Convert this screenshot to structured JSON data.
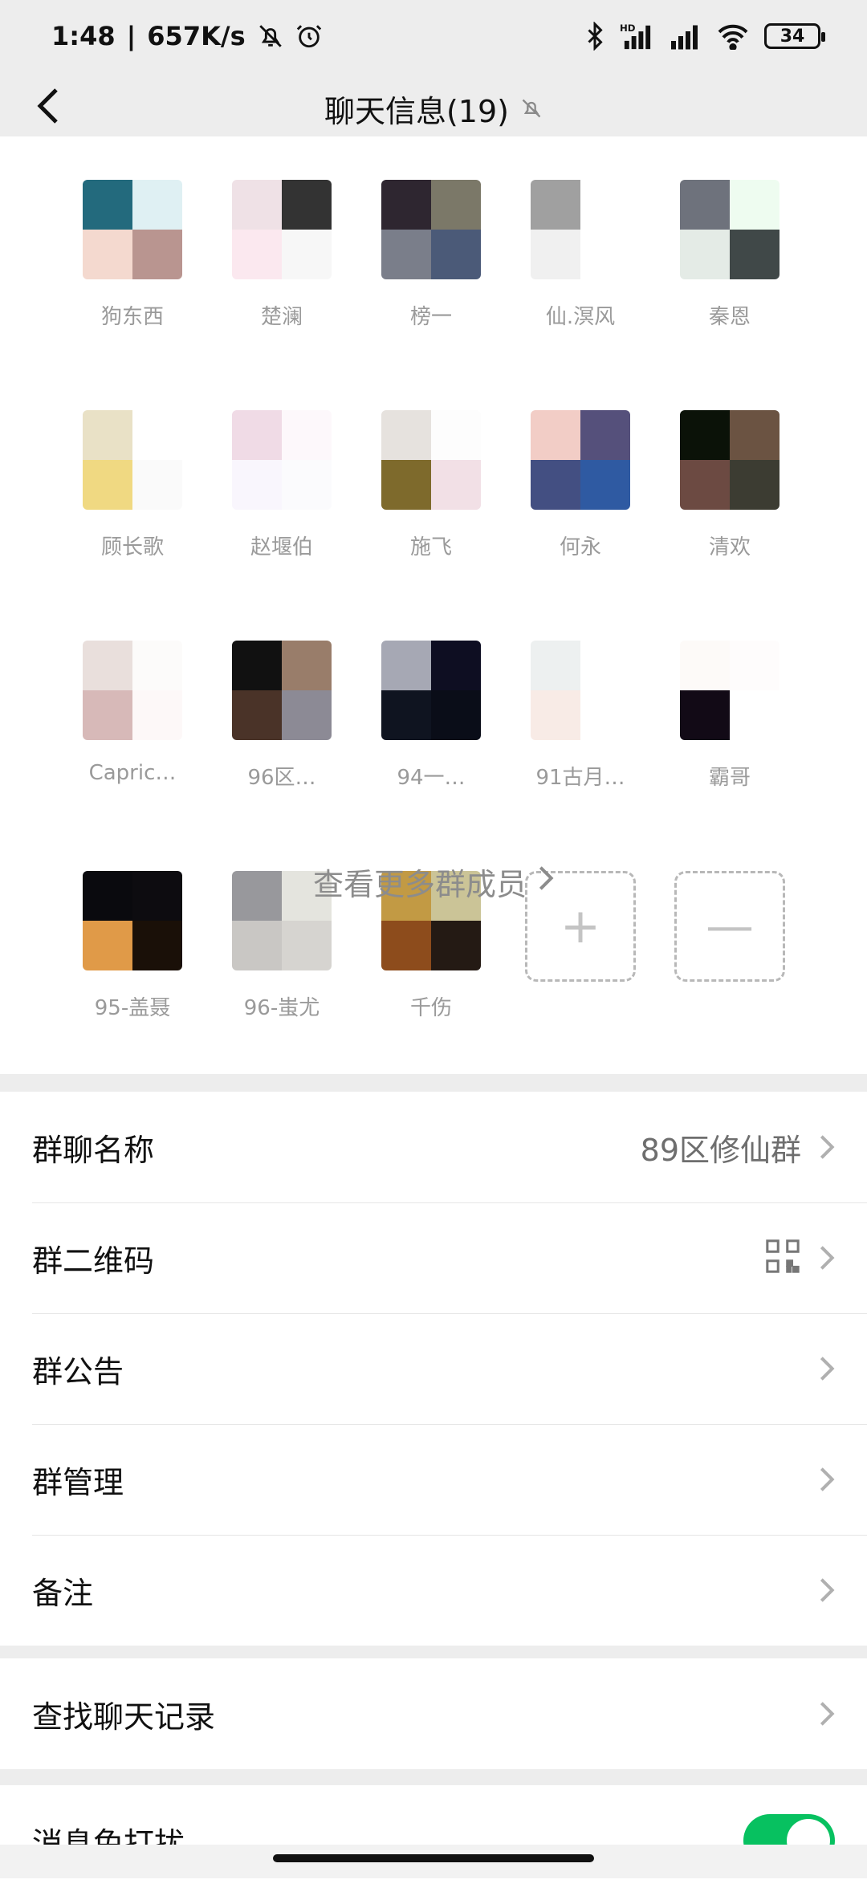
{
  "status_bar": {
    "time": "1:48",
    "network_speed": "657K/s",
    "battery": "34",
    "icons": [
      "bell-off-icon",
      "alarm-icon",
      "bluetooth-icon",
      "signal-hd-icon",
      "signal-icon",
      "wifi-icon",
      "battery-icon"
    ]
  },
  "header": {
    "title": "聊天信息(19)",
    "back_icon": "chevron-left-icon",
    "mute_icon": "bell-off-icon"
  },
  "members": [
    {
      "name": "狗东西",
      "colors": [
        "#236a7d",
        "#dff0f3",
        "#f4d9cf",
        "#b99590"
      ]
    },
    {
      "name": "楚澜",
      "colors": [
        "#efe1e6",
        "#333333",
        "#fbe8ef",
        "#f7f7f7"
      ]
    },
    {
      "name": "榜一",
      "colors": [
        "#2e2630",
        "#7b7868",
        "#7a7e8a",
        "#4b5a78"
      ]
    },
    {
      "name": "仙.溟风",
      "colors": [
        "#a0a0a0",
        "#ffffff",
        "#f0f0f0",
        "#ffffff"
      ]
    },
    {
      "name": "秦恩",
      "colors": [
        "#6e727c",
        "#eefcf0",
        "#e4ebe6",
        "#404848"
      ]
    },
    {
      "name": "顾长歌",
      "colors": [
        "#e9e1c6",
        "#ffffff",
        "#f0d982",
        "#fafafa"
      ]
    },
    {
      "name": "赵堰伯",
      "colors": [
        "#f0dbe6",
        "#fdf8fb",
        "#f9f6fd",
        "#fbfbfd"
      ]
    },
    {
      "name": "施飞",
      "colors": [
        "#e6e2de",
        "#fdfdfd",
        "#7e6a2c",
        "#f2e0e6"
      ]
    },
    {
      "name": "何永",
      "colors": [
        "#f2cdc6",
        "#55507b",
        "#434f82",
        "#2f5aa2"
      ]
    },
    {
      "name": "清欢",
      "colors": [
        "#0b1208",
        "#6b5342",
        "#6c4a42",
        "#3c3c32"
      ]
    },
    {
      "name": "Capric…",
      "colors": [
        "#e9dfdc",
        "#fcfbfa",
        "#d7b9b8",
        "#fdf8f8"
      ]
    },
    {
      "name": "96区…",
      "colors": [
        "#111111",
        "#997d6a",
        "#4a3328",
        "#8c8a95"
      ]
    },
    {
      "name": "94一…",
      "colors": [
        "#a6a8b4",
        "#0e0e22",
        "#0f1420",
        "#0a0d18"
      ]
    },
    {
      "name": "91古月…",
      "colors": [
        "#edf0f0",
        "#ffffff",
        "#f8ebe6",
        "#ffffff"
      ]
    },
    {
      "name": "霸哥",
      "colors": [
        "#fdfaf8",
        "#fefcfc",
        "#120a16",
        "#ffffff"
      ]
    },
    {
      "name": "95-盖聂",
      "colors": [
        "#0a0a0e",
        "#0d0c10",
        "#e09a48",
        "#1a1008"
      ]
    },
    {
      "name": "96-蚩尤",
      "colors": [
        "#98989c",
        "#e4e4de",
        "#c9c7c4",
        "#d6d4d0"
      ]
    },
    {
      "name": "千伤",
      "colors": [
        "#c29a44",
        "#cbc497",
        "#8d4c1c",
        "#241a14"
      ]
    }
  ],
  "add_member_icon": "plus-icon",
  "add_member_symbol": "+",
  "remove_member_icon": "minus-icon",
  "remove_member_symbol": "—",
  "view_more": "查看更多群成员",
  "settings": {
    "group_name_label": "群聊名称",
    "group_name_value": "89区修仙群",
    "qr_label": "群二维码",
    "announcement_label": "群公告",
    "manage_label": "群管理",
    "remark_label": "备注",
    "search_history_label": "查找聊天记录",
    "mute_label": "消息免打扰",
    "mute_enabled": true
  },
  "colors": {
    "accent_green": "#07c160",
    "background": "#ededed"
  }
}
